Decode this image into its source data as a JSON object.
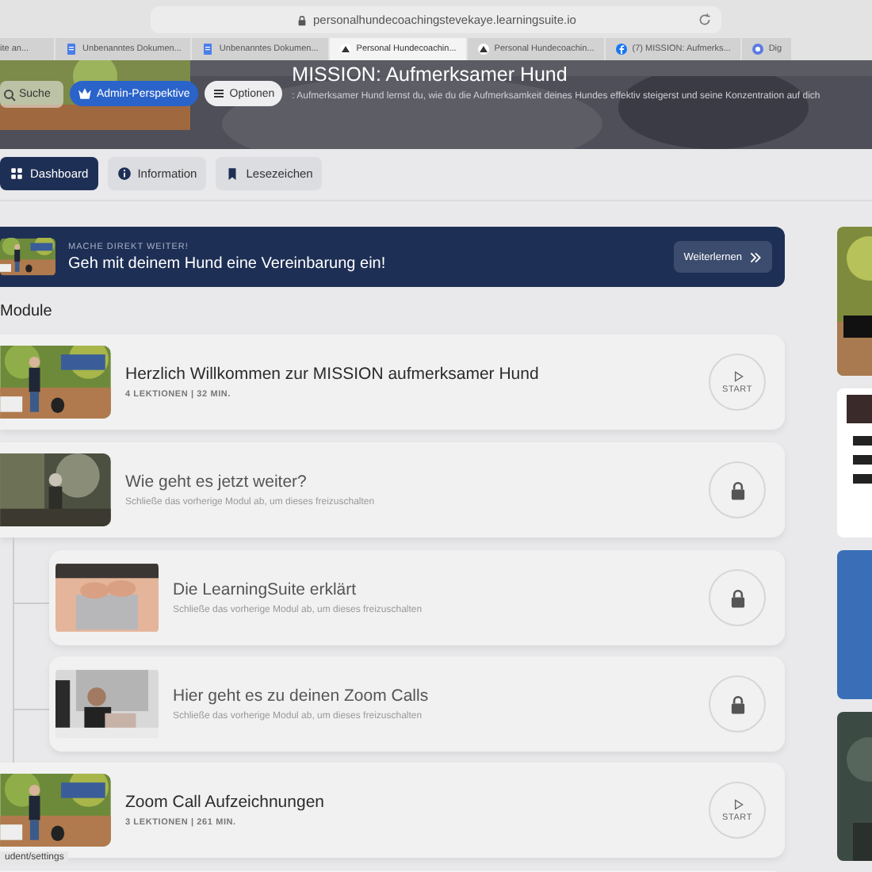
{
  "browser": {
    "url": "personalhundecoachingstevekaye.learningsuite.io",
    "tabs": [
      {
        "title": "ite an...",
        "kind": "plain",
        "selected": false
      },
      {
        "title": "Unbenanntes Dokumen...",
        "kind": "doc",
        "selected": false
      },
      {
        "title": "Unbenanntes Dokumen...",
        "kind": "doc",
        "selected": false
      },
      {
        "title": "Personal Hundecoachin...",
        "kind": "peak",
        "selected": true
      },
      {
        "title": "Personal Hundecoachin...",
        "kind": "peak",
        "selected": false
      },
      {
        "title": "(7) MISSION: Aufmerks...",
        "kind": "facebook",
        "selected": false
      },
      {
        "title": "Dig",
        "kind": "circle",
        "selected": false
      }
    ]
  },
  "header": {
    "title": "MISSION: Aufmerksamer Hund",
    "description": ": Aufmerksamer Hund lernst du, wie du die Aufmerksamkeit deines Hundes effektiv steigerst und seine Konzentration auf dich",
    "search_placeholder": "Suche",
    "buttons": [
      {
        "label": "Admin-Perspektive",
        "kind": "admin"
      },
      {
        "label": "Optionen",
        "kind": "options"
      }
    ]
  },
  "nav_tabs": [
    {
      "label": "Dashboard",
      "kind": "grid",
      "selected": true
    },
    {
      "label": "Information",
      "kind": "info",
      "selected": false
    },
    {
      "label": "Lesezeichen",
      "kind": "bookmark",
      "selected": false
    }
  ],
  "continue_banner": {
    "eyebrow": "MACHE DIREKT WEITER!",
    "title": "Geh mit deinem Hund eine Vereinbarung ein!",
    "button": "Weiterlernen"
  },
  "modules_heading": "Module",
  "modules": [
    {
      "title": "Herzlich Willkommen zur MISSION aufmerksamer Hund",
      "subtitle": "4 LEKTIONEN | 32 MIN.",
      "locked": false,
      "action": "START"
    },
    {
      "title": "Wie geht es jetzt weiter?",
      "subtitle": "Schließe das vorherige Modul ab, um dieses freizuschalten",
      "locked": true,
      "children": [
        {
          "title": "Die LearningSuite erklärt",
          "subtitle": "Schließe das vorherige Modul ab, um dieses freizuschalten",
          "locked": true
        },
        {
          "title": "Hier geht es zu deinen Zoom Calls",
          "subtitle": "Schließe das vorherige Modul ab, um dieses freizuschalten",
          "locked": true
        }
      ]
    },
    {
      "title": "Zoom Call Aufzeichnungen",
      "subtitle": "3 LEKTIONEN | 261 MIN.",
      "locked": false,
      "action": "START"
    }
  ],
  "status_url": "udent/settings"
}
